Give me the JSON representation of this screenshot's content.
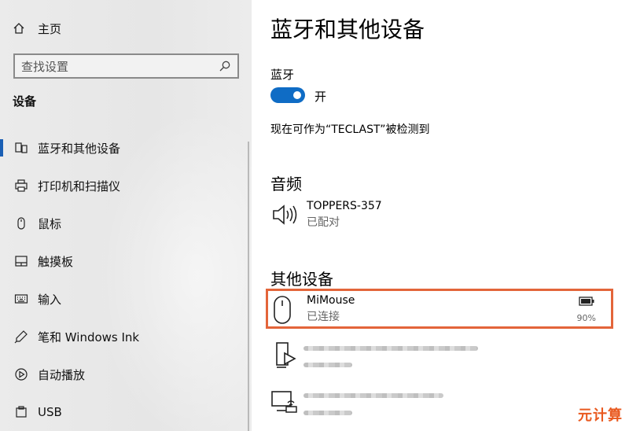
{
  "sidebar": {
    "home_label": "主页",
    "search_placeholder": "查找设置",
    "section_title": "设备",
    "items": [
      {
        "label": "蓝牙和其他设备",
        "icon": "bluetooth-devices-icon",
        "active": true
      },
      {
        "label": "打印机和扫描仪",
        "icon": "printer-icon"
      },
      {
        "label": "鼠标",
        "icon": "mouse-icon"
      },
      {
        "label": "触摸板",
        "icon": "touchpad-icon"
      },
      {
        "label": "输入",
        "icon": "keyboard-icon"
      },
      {
        "label": "笔和 Windows Ink",
        "icon": "pen-icon"
      },
      {
        "label": "自动播放",
        "icon": "autoplay-icon"
      },
      {
        "label": "USB",
        "icon": "usb-icon"
      }
    ]
  },
  "main": {
    "title": "蓝牙和其他设备",
    "bluetooth_label": "蓝牙",
    "toggle_state": "开",
    "discoverable_text": "现在可作为“TECLAST”被检测到",
    "audio_heading": "音频",
    "audio_device": {
      "name": "TOPPERS-357",
      "status": "已配对",
      "icon": "speaker-icon"
    },
    "other_heading": "其他设备",
    "mouse_device": {
      "name": "MiMouse",
      "status": "已连接",
      "battery": "90%",
      "icon": "mouse-icon"
    },
    "blurred_devices": [
      {
        "icon": "media-device-icon"
      },
      {
        "icon": "display-device-icon"
      }
    ]
  },
  "colors": {
    "accent": "#0f6cc5",
    "highlight_border": "#e3653a",
    "watermark": "#e9591f"
  },
  "watermark": "元计算"
}
